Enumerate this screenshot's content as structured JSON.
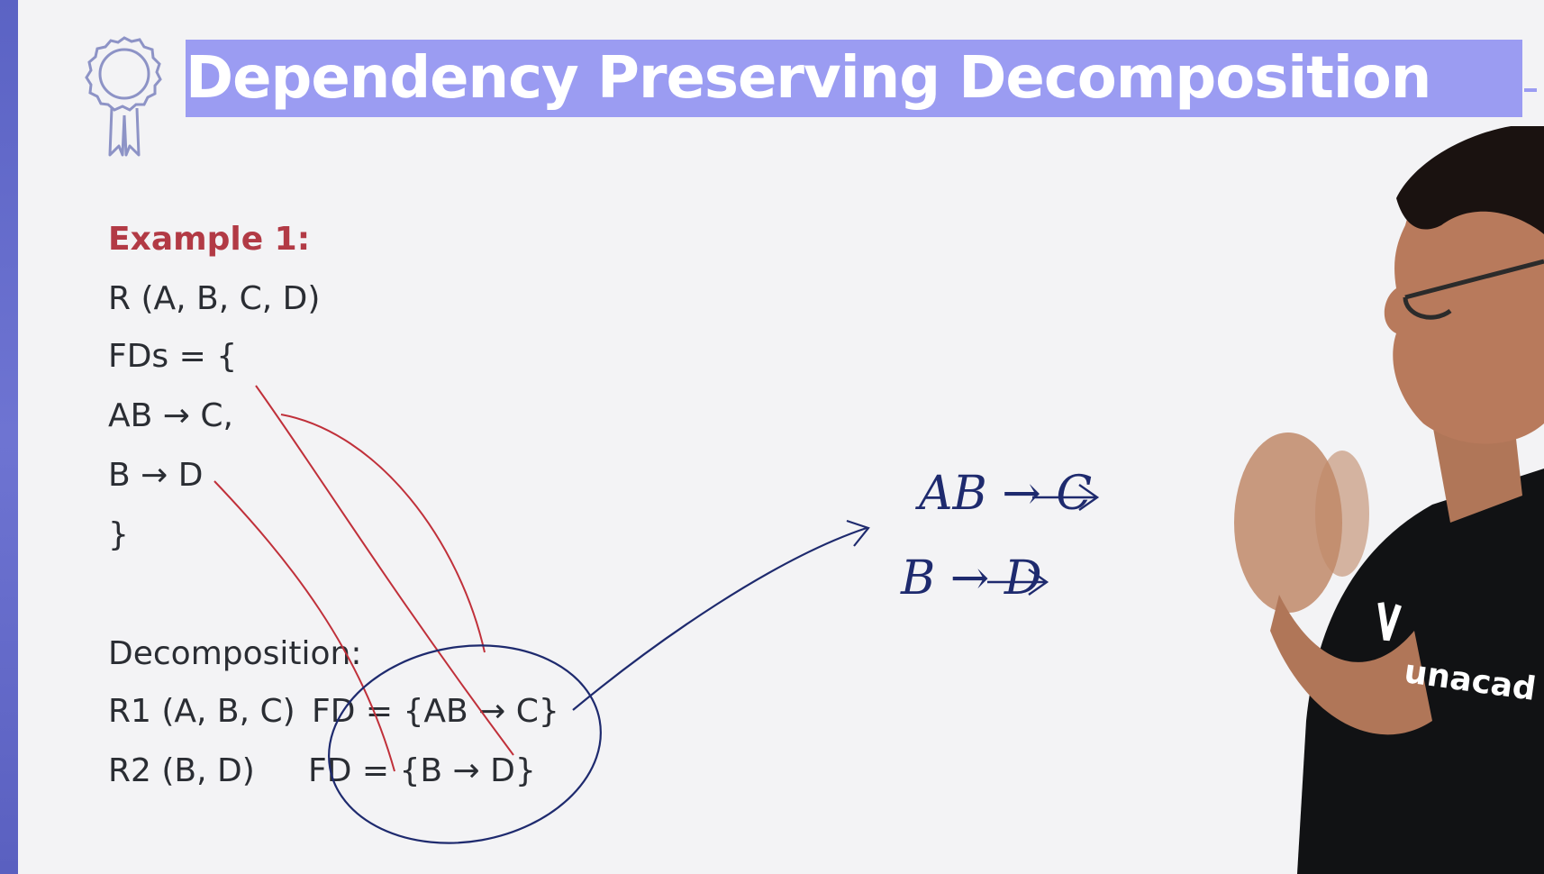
{
  "slide": {
    "title": "Dependency Preserving Decomposition",
    "example_heading": "Example 1:",
    "relation": "R (A, B, C, D)",
    "fds_open": "FDs = {",
    "fd_1": "AB → C,",
    "fd_2": "B → D",
    "fds_close": "}",
    "decomposition_heading": "Decomposition:",
    "r1_relation": "R1 (A, B, C)",
    "r1_fd": "FD = {AB → C}",
    "r2_relation": "R2 (B, D)",
    "r2_fd": "FD = {B → D}"
  },
  "annotations": {
    "handwritten_fd_1": "AB → C",
    "handwritten_fd_2": "B → D"
  },
  "presenter": {
    "shirt_text": "unacad"
  },
  "icons": {
    "badge": "award-ribbon-icon",
    "shirt_logo": "unacademy-logo-icon"
  },
  "colors": {
    "title_band": "#9b9cf2",
    "title_text": "#ffffff",
    "left_bar": "#5b63c4",
    "heading_red": "#b23a45",
    "body_text": "#2a2d33",
    "red_ink": "#c0303a",
    "blue_ink": "#1e2a6e",
    "background": "#f3f3f5"
  }
}
